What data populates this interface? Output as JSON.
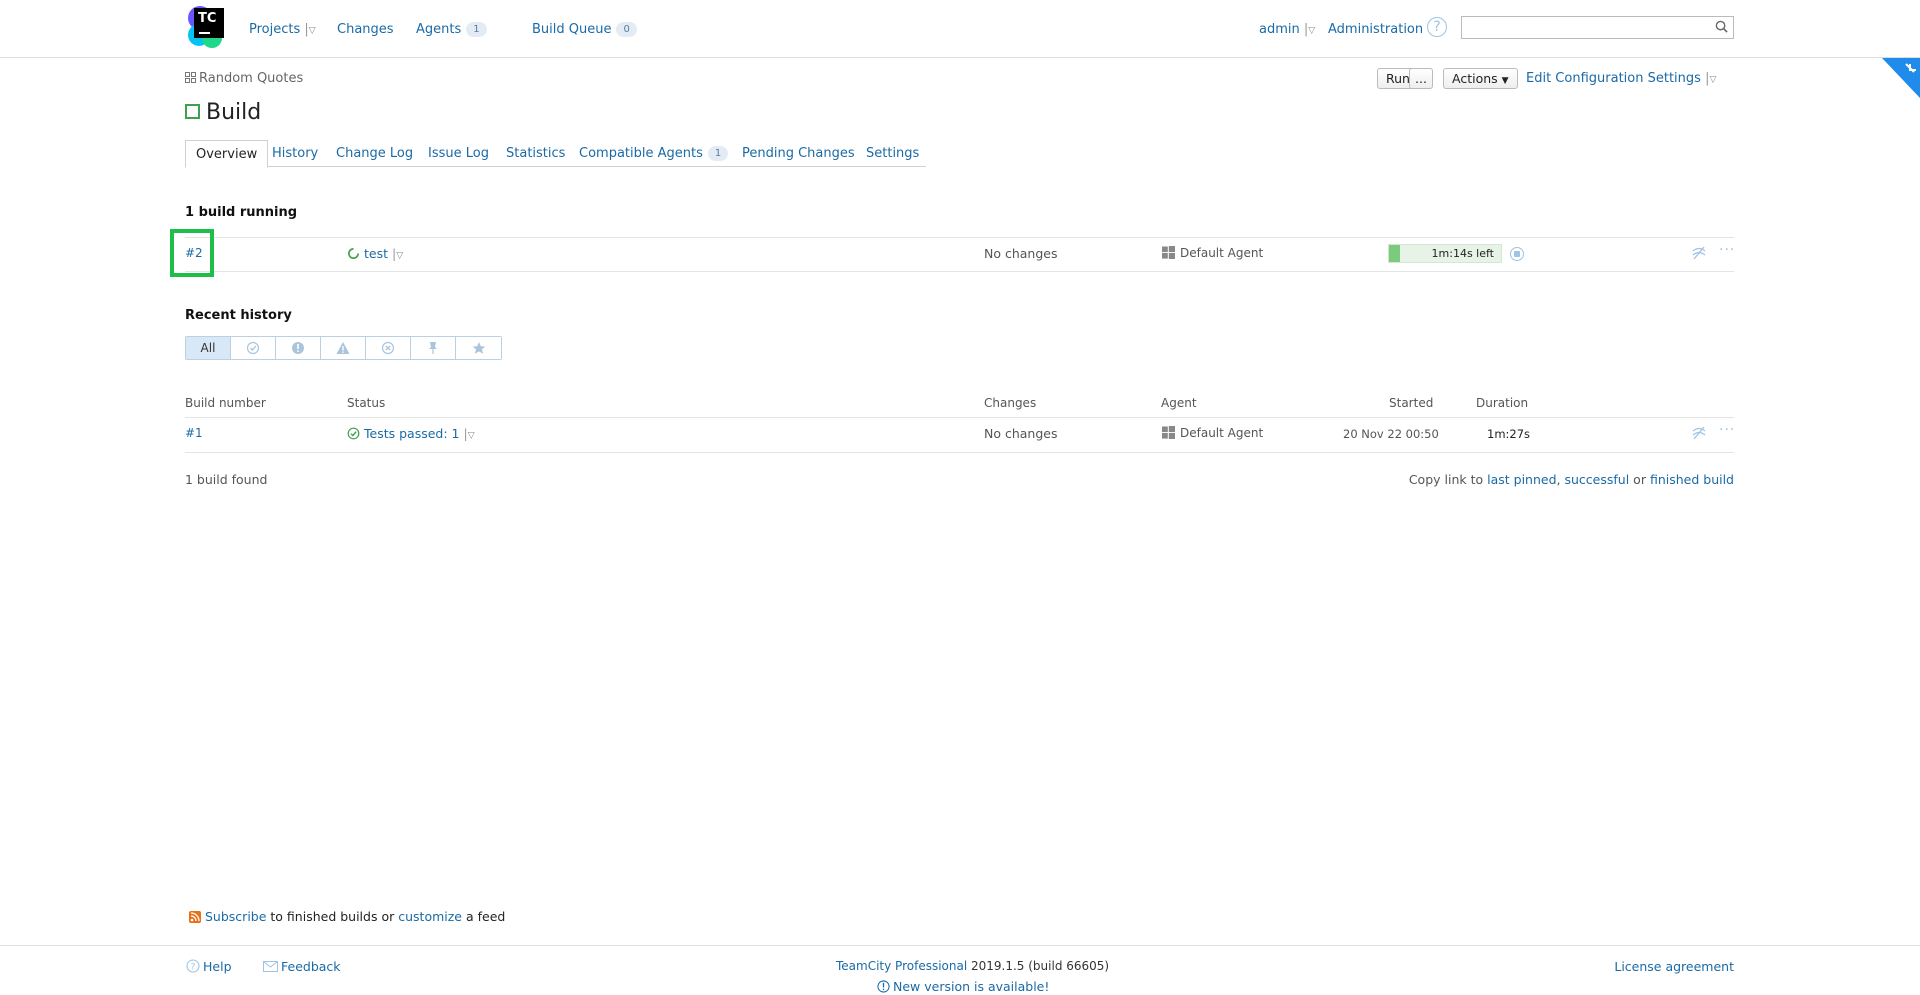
{
  "header": {
    "logo_text": "TC",
    "nav": {
      "projects": "Projects",
      "changes": "Changes",
      "agents": "Agents",
      "agents_count": "1",
      "build_queue": "Build Queue",
      "build_queue_count": "0"
    },
    "user": "admin",
    "administration": "Administration",
    "help": "?",
    "search_placeholder": ""
  },
  "page": {
    "breadcrumb": "Random Quotes",
    "title": "Build",
    "run_label": "Run",
    "run_more_label": "...",
    "actions_label": "Actions",
    "edit_settings_label": "Edit Configuration Settings"
  },
  "tabs": [
    {
      "label": "Overview"
    },
    {
      "label": "History"
    },
    {
      "label": "Change Log"
    },
    {
      "label": "Issue Log"
    },
    {
      "label": "Statistics"
    },
    {
      "label": "Compatible Agents",
      "count": "1"
    },
    {
      "label": "Pending Changes"
    },
    {
      "label": "Settings"
    }
  ],
  "running": {
    "heading": "1 build running",
    "build_number": "#2",
    "status": "test",
    "changes": "No changes",
    "agent": "Default Agent",
    "time_left": "1m:14s left",
    "progress_fraction": 0.1
  },
  "history": {
    "heading": "Recent history",
    "filter_all": "All",
    "columns": {
      "build_number": "Build number",
      "status": "Status",
      "changes": "Changes",
      "agent": "Agent",
      "started": "Started",
      "duration": "Duration"
    },
    "rows": [
      {
        "build_number": "#1",
        "status": "Tests passed: 1",
        "changes": "No changes",
        "agent": "Default Agent",
        "started": "20 Nov 22 00:50",
        "duration": "1m:27s"
      }
    ],
    "found": "1 build found",
    "copy_link_prefix": "Copy link to",
    "last_pinned": "last pinned",
    "successful": "successful",
    "or": "or",
    "finished_build": "finished build"
  },
  "feed": {
    "subscribe": "Subscribe",
    "middle": "to finished builds or",
    "customize": "customize",
    "end": "a feed"
  },
  "footer": {
    "help": "Help",
    "feedback": "Feedback",
    "product": "TeamCity Professional",
    "version": "2019.1.5 (build 66605)",
    "new_version": "New version is available!",
    "license": "License agreement"
  },
  "colors": {
    "link": "#1a6aa6",
    "success": "#3fa04d",
    "highlight": "#1dbf48",
    "progress": "#7ccb7c"
  }
}
